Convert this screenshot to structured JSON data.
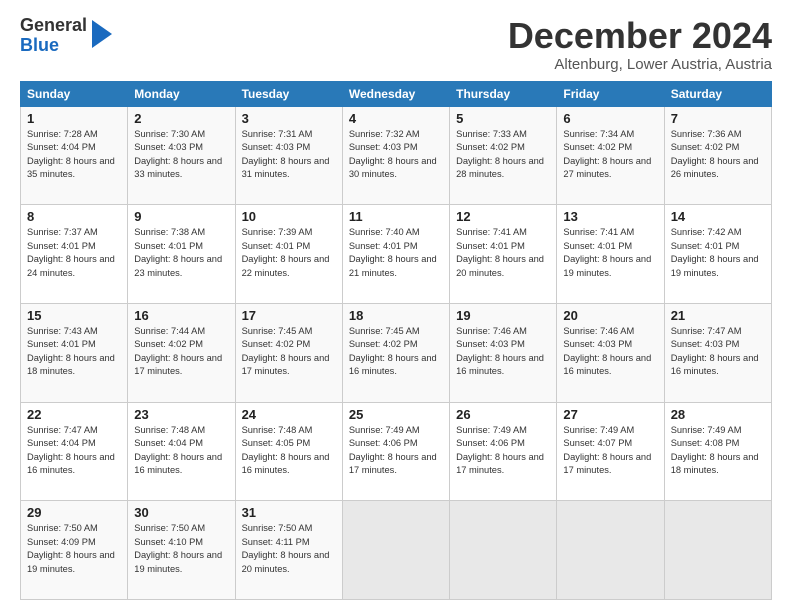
{
  "logo": {
    "general": "General",
    "blue": "Blue"
  },
  "title": "December 2024",
  "subtitle": "Altenburg, Lower Austria, Austria",
  "weekdays": [
    "Sunday",
    "Monday",
    "Tuesday",
    "Wednesday",
    "Thursday",
    "Friday",
    "Saturday"
  ],
  "weeks": [
    [
      {
        "day": "1",
        "sunrise": "7:28 AM",
        "sunset": "4:04 PM",
        "daylight": "8 hours and 35 minutes."
      },
      {
        "day": "2",
        "sunrise": "7:30 AM",
        "sunset": "4:03 PM",
        "daylight": "8 hours and 33 minutes."
      },
      {
        "day": "3",
        "sunrise": "7:31 AM",
        "sunset": "4:03 PM",
        "daylight": "8 hours and 31 minutes."
      },
      {
        "day": "4",
        "sunrise": "7:32 AM",
        "sunset": "4:03 PM",
        "daylight": "8 hours and 30 minutes."
      },
      {
        "day": "5",
        "sunrise": "7:33 AM",
        "sunset": "4:02 PM",
        "daylight": "8 hours and 28 minutes."
      },
      {
        "day": "6",
        "sunrise": "7:34 AM",
        "sunset": "4:02 PM",
        "daylight": "8 hours and 27 minutes."
      },
      {
        "day": "7",
        "sunrise": "7:36 AM",
        "sunset": "4:02 PM",
        "daylight": "8 hours and 26 minutes."
      }
    ],
    [
      {
        "day": "8",
        "sunrise": "7:37 AM",
        "sunset": "4:01 PM",
        "daylight": "8 hours and 24 minutes."
      },
      {
        "day": "9",
        "sunrise": "7:38 AM",
        "sunset": "4:01 PM",
        "daylight": "8 hours and 23 minutes."
      },
      {
        "day": "10",
        "sunrise": "7:39 AM",
        "sunset": "4:01 PM",
        "daylight": "8 hours and 22 minutes."
      },
      {
        "day": "11",
        "sunrise": "7:40 AM",
        "sunset": "4:01 PM",
        "daylight": "8 hours and 21 minutes."
      },
      {
        "day": "12",
        "sunrise": "7:41 AM",
        "sunset": "4:01 PM",
        "daylight": "8 hours and 20 minutes."
      },
      {
        "day": "13",
        "sunrise": "7:41 AM",
        "sunset": "4:01 PM",
        "daylight": "8 hours and 19 minutes."
      },
      {
        "day": "14",
        "sunrise": "7:42 AM",
        "sunset": "4:01 PM",
        "daylight": "8 hours and 19 minutes."
      }
    ],
    [
      {
        "day": "15",
        "sunrise": "7:43 AM",
        "sunset": "4:01 PM",
        "daylight": "8 hours and 18 minutes."
      },
      {
        "day": "16",
        "sunrise": "7:44 AM",
        "sunset": "4:02 PM",
        "daylight": "8 hours and 17 minutes."
      },
      {
        "day": "17",
        "sunrise": "7:45 AM",
        "sunset": "4:02 PM",
        "daylight": "8 hours and 17 minutes."
      },
      {
        "day": "18",
        "sunrise": "7:45 AM",
        "sunset": "4:02 PM",
        "daylight": "8 hours and 16 minutes."
      },
      {
        "day": "19",
        "sunrise": "7:46 AM",
        "sunset": "4:03 PM",
        "daylight": "8 hours and 16 minutes."
      },
      {
        "day": "20",
        "sunrise": "7:46 AM",
        "sunset": "4:03 PM",
        "daylight": "8 hours and 16 minutes."
      },
      {
        "day": "21",
        "sunrise": "7:47 AM",
        "sunset": "4:03 PM",
        "daylight": "8 hours and 16 minutes."
      }
    ],
    [
      {
        "day": "22",
        "sunrise": "7:47 AM",
        "sunset": "4:04 PM",
        "daylight": "8 hours and 16 minutes."
      },
      {
        "day": "23",
        "sunrise": "7:48 AM",
        "sunset": "4:04 PM",
        "daylight": "8 hours and 16 minutes."
      },
      {
        "day": "24",
        "sunrise": "7:48 AM",
        "sunset": "4:05 PM",
        "daylight": "8 hours and 16 minutes."
      },
      {
        "day": "25",
        "sunrise": "7:49 AM",
        "sunset": "4:06 PM",
        "daylight": "8 hours and 17 minutes."
      },
      {
        "day": "26",
        "sunrise": "7:49 AM",
        "sunset": "4:06 PM",
        "daylight": "8 hours and 17 minutes."
      },
      {
        "day": "27",
        "sunrise": "7:49 AM",
        "sunset": "4:07 PM",
        "daylight": "8 hours and 17 minutes."
      },
      {
        "day": "28",
        "sunrise": "7:49 AM",
        "sunset": "4:08 PM",
        "daylight": "8 hours and 18 minutes."
      }
    ],
    [
      {
        "day": "29",
        "sunrise": "7:50 AM",
        "sunset": "4:09 PM",
        "daylight": "8 hours and 19 minutes."
      },
      {
        "day": "30",
        "sunrise": "7:50 AM",
        "sunset": "4:10 PM",
        "daylight": "8 hours and 19 minutes."
      },
      {
        "day": "31",
        "sunrise": "7:50 AM",
        "sunset": "4:11 PM",
        "daylight": "8 hours and 20 minutes."
      },
      null,
      null,
      null,
      null
    ]
  ]
}
